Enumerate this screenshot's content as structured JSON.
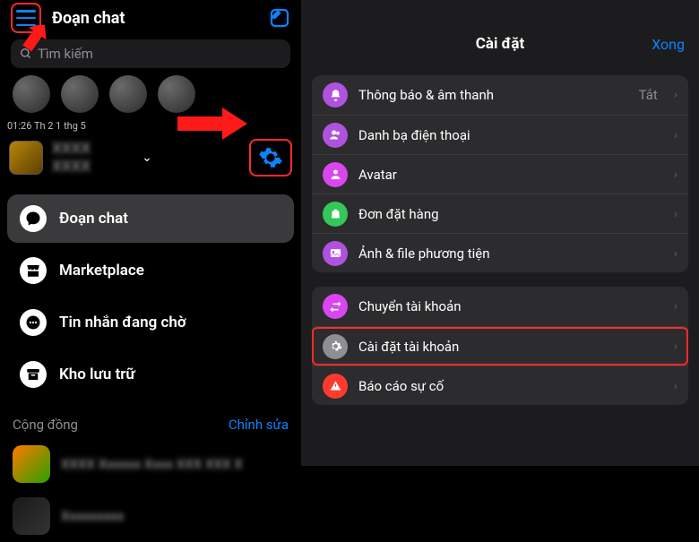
{
  "left": {
    "header_title": "Đoạn chat",
    "search_placeholder": "Tìm kiếm",
    "status": "01:26  Th 2 1 thg 5",
    "profile_name": "XXXX XXXX",
    "nav": [
      {
        "label": "Đoạn chat"
      },
      {
        "label": "Marketplace"
      },
      {
        "label": "Tin nhắn đang chờ"
      },
      {
        "label": "Kho lưu trữ"
      }
    ],
    "community_label": "Cộng đồng",
    "community_edit": "Chỉnh sửa",
    "community_items": [
      {
        "label": "XXXX Xxxxxx Xxxx XXX XXX X"
      },
      {
        "label": "Xxxxxxxxx"
      }
    ]
  },
  "right": {
    "title": "Cài đặt",
    "done": "Xong",
    "group1": [
      {
        "label": "Thông báo & âm thanh",
        "value": "Tắt",
        "icon": "bell",
        "color": "ic-purple"
      },
      {
        "label": "Danh bạ điện thoại",
        "icon": "contacts",
        "color": "ic-purple"
      },
      {
        "label": "Avatar",
        "icon": "avatar",
        "color": "ic-pink"
      },
      {
        "label": "Đơn đặt hàng",
        "icon": "bag",
        "color": "ic-green"
      },
      {
        "label": "Ảnh & file phương tiện",
        "icon": "media",
        "color": "ic-purple"
      }
    ],
    "group2": [
      {
        "label": "Chuyển tài khoản",
        "icon": "switch",
        "color": "ic-pink"
      },
      {
        "label": "Cài đặt tài khoản",
        "icon": "gear",
        "color": "ic-grey",
        "highlight": true
      },
      {
        "label": "Báo cáo sự cố",
        "icon": "alert",
        "color": "ic-red"
      }
    ]
  }
}
